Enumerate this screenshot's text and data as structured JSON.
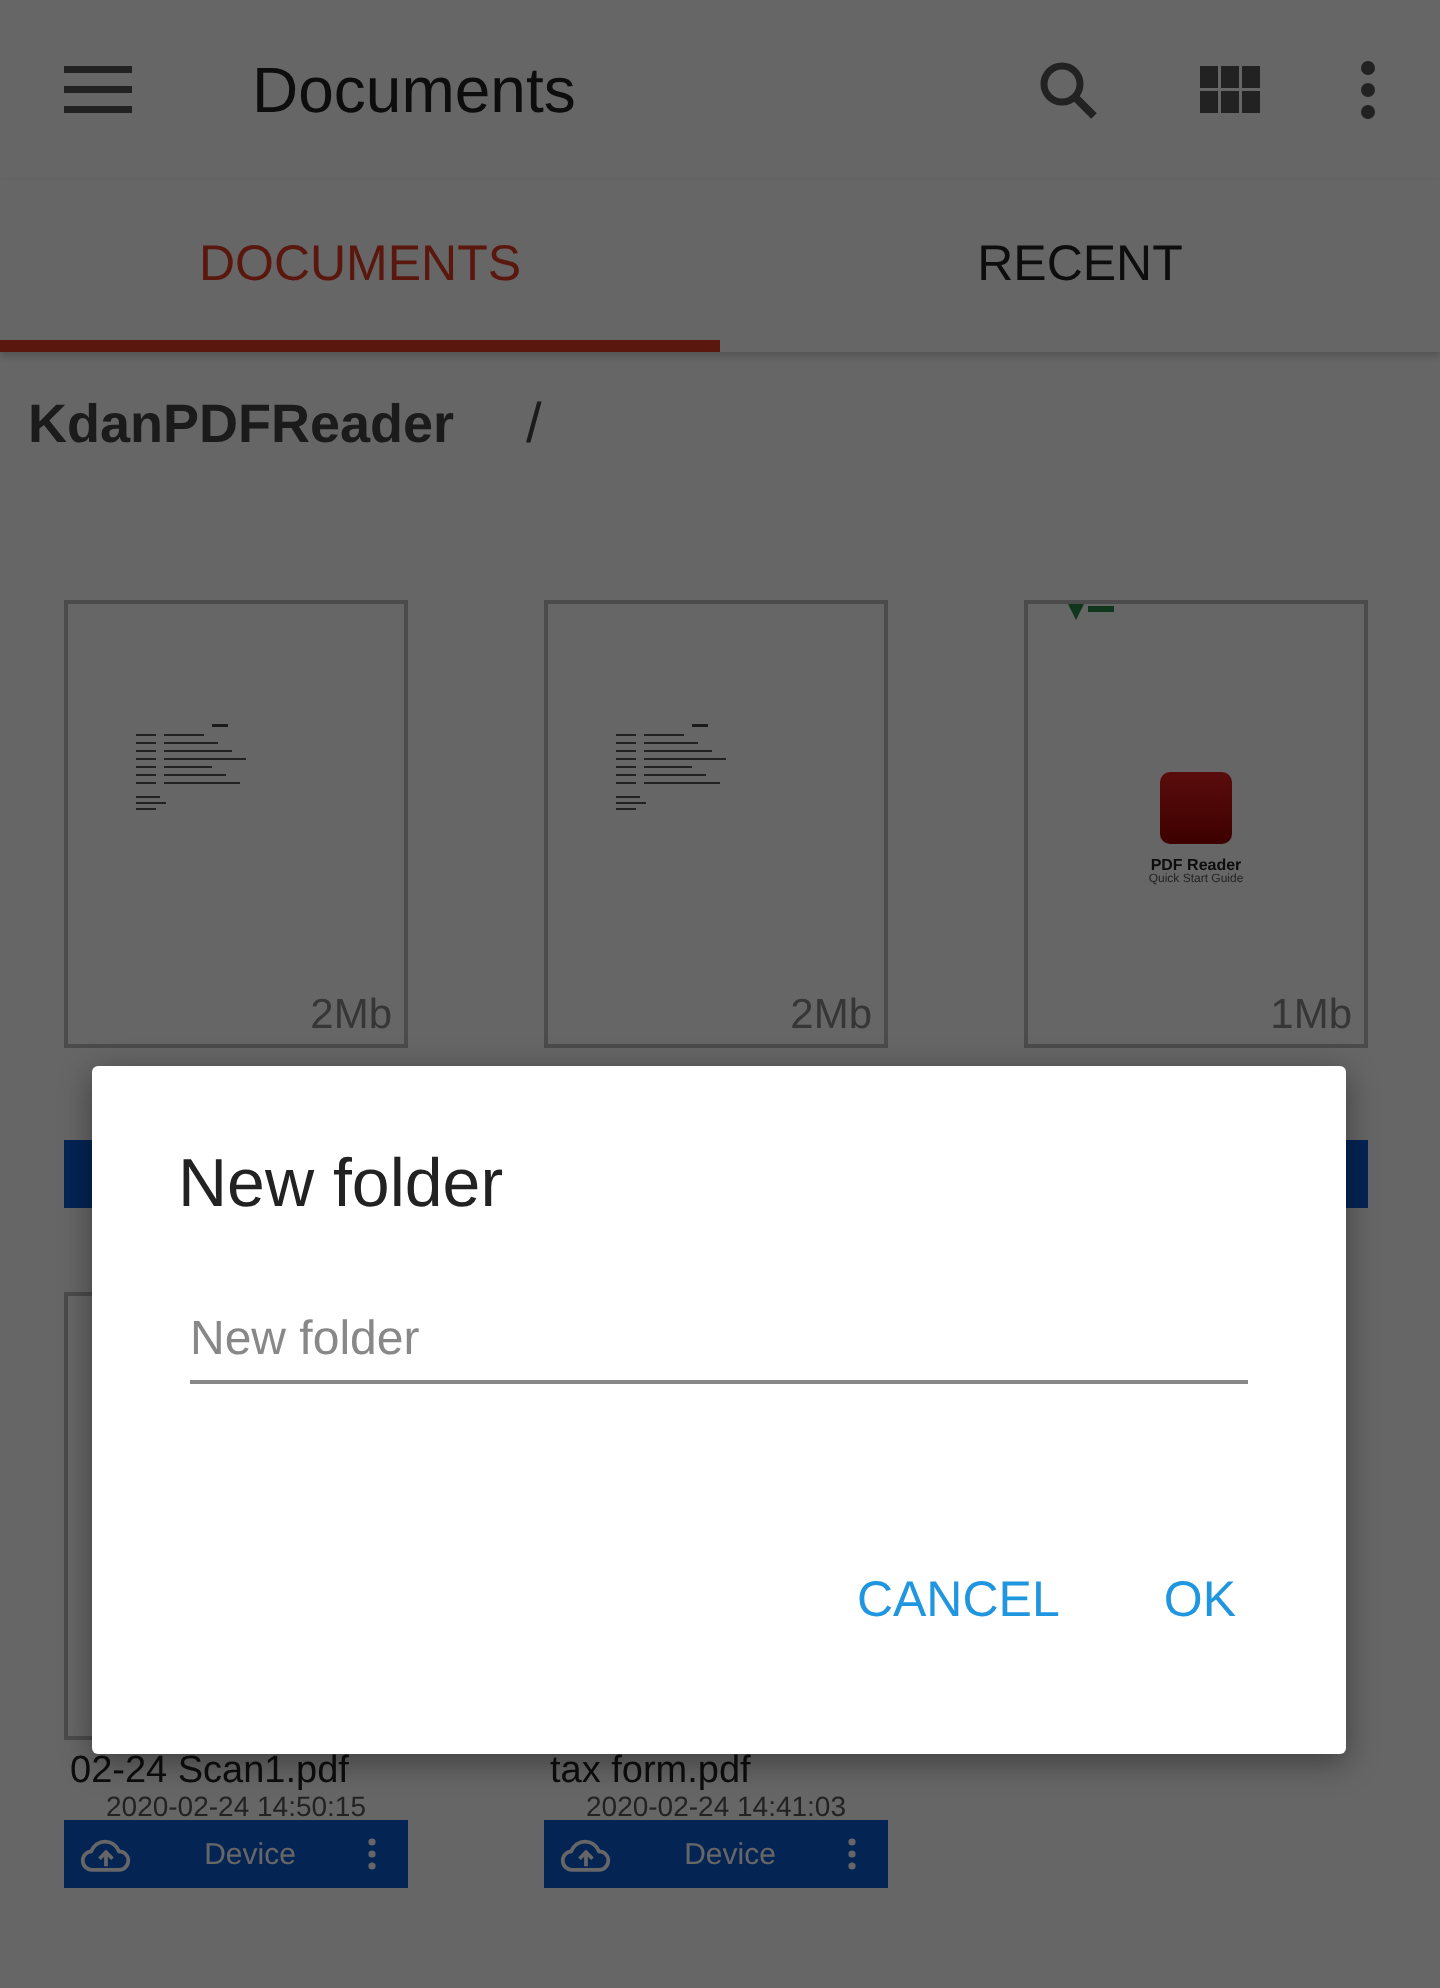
{
  "app_bar": {
    "title": "Documents"
  },
  "tabs": [
    {
      "label": "DOCUMENTS",
      "selected": true
    },
    {
      "label": "RECENT",
      "selected": false
    }
  ],
  "breadcrumb": {
    "folder": "KdanPDFReader",
    "separator": "/"
  },
  "files": [
    {
      "kind": "text",
      "size": "2Mb"
    },
    {
      "kind": "text",
      "size": "2Mb"
    },
    {
      "kind": "guide",
      "size": "1Mb",
      "guide_title": "PDF Reader",
      "guide_subtitle": "Quick Start Guide"
    },
    {
      "kind": "hidden",
      "name": "02-24 Scan1.pdf",
      "date": "2020-02-24 14:50:15",
      "location": "Device"
    },
    {
      "kind": "hidden",
      "name": "tax form.pdf",
      "date": "2020-02-24 14:41:03",
      "location": "Device"
    }
  ],
  "dialog": {
    "title": "New folder",
    "field": {
      "placeholder": "New folder"
    },
    "buttons": [
      "CANCEL",
      "OK"
    ]
  }
}
